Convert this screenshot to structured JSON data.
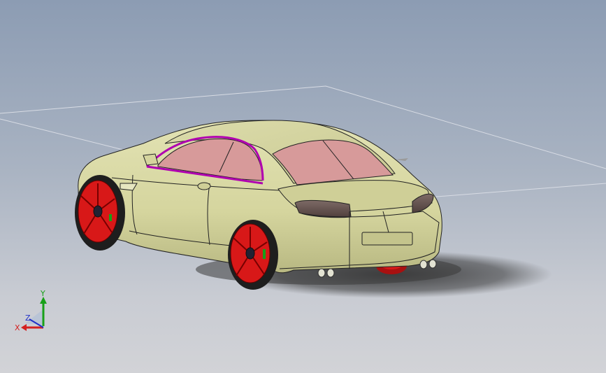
{
  "triad": {
    "x_label": "X",
    "y_label": "Y",
    "z_label": "Z",
    "x_color": "#d42020",
    "y_color": "#18a018",
    "z_color": "#2030c8"
  },
  "scene": {
    "background_top": "#8c9cb3",
    "background_bottom": "#d2d3d7",
    "body_color": "#d7d7a0",
    "glass_color": "#d79a9a",
    "wheel_color": "#d81818",
    "tail_light_color": "#6a5652",
    "highlight_edge_color": "#b000b0"
  }
}
